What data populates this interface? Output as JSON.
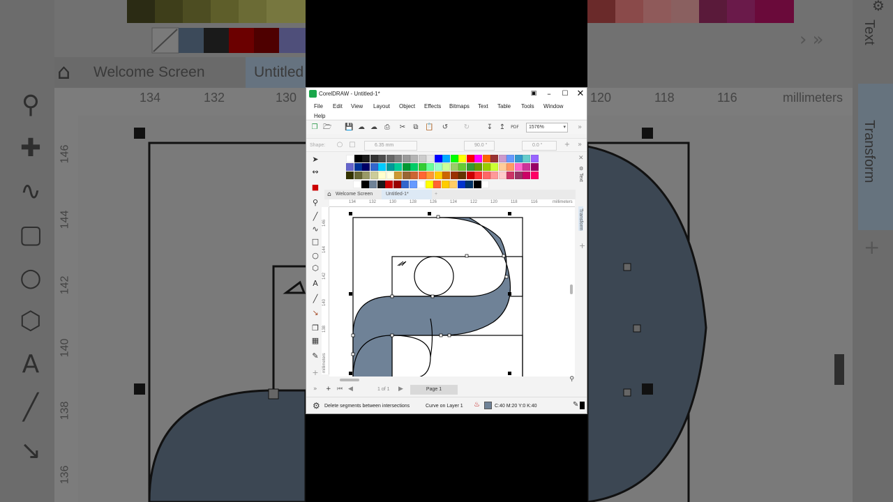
{
  "app": {
    "title": "CorelDRAW - Untitled-1*",
    "logo_color": "#1aa64a",
    "window_controls": [
      "minimize-icon",
      "maximize-icon",
      "close-icon"
    ]
  },
  "menus": [
    "File",
    "Edit",
    "View",
    "Layout",
    "Object",
    "Effects",
    "Bitmaps",
    "Text",
    "Table",
    "Tools",
    "Window",
    "Help"
  ],
  "toolbar": {
    "icons": [
      "new-document-icon",
      "open-icon",
      "save-icon",
      "cloud-download-icon",
      "cloud-upload-icon",
      "print-icon",
      "cut-icon",
      "copy-icon",
      "paste-icon",
      "undo-icon",
      "redo-icon",
      "import-icon",
      "export-icon",
      "pdf-icon"
    ],
    "pdf_label": "PDF",
    "zoom_value": "1576%"
  },
  "property_bar": {
    "shape_label": "Shape:",
    "outline_width": "6.35 mm",
    "angle_1": "90.0 °",
    "angle_2": "0.0 °"
  },
  "palette": {
    "rows": [
      [
        "#ffffff",
        "#000000",
        "#1a1a1a",
        "#333333",
        "#4d4d4d",
        "#666666",
        "#808080",
        "#999999",
        "#b3b3b3",
        "#cccccc",
        "#e6e6e6",
        "#0000ff",
        "#00aaff",
        "#00ff00",
        "#ffff00",
        "#ff0000",
        "#ff00ff",
        "#ff6600",
        "#993333",
        "#cc99cc",
        "#6699ff",
        "#3399cc",
        "#66cccc",
        "#9966ff"
      ],
      [
        "#6666cc",
        "#003399",
        "#000066",
        "#3366cc",
        "#00ccff",
        "#009999",
        "#00cc99",
        "#009933",
        "#00cc66",
        "#33cc33",
        "#66ff99",
        "#99ffcc",
        "#ccff99",
        "#99cc66",
        "#66cc33",
        "#339933",
        "#669900",
        "#99cc00",
        "#ccff33",
        "#ffcc99",
        "#ff9966",
        "#ff66cc",
        "#cc3399",
        "#990066"
      ],
      [
        "#333300",
        "#666633",
        "#999966",
        "#cccc99",
        "#ffffcc",
        "#ffffe0",
        "#cc9933",
        "#996633",
        "#cc6633",
        "#ff6633",
        "#ff9933",
        "#ffcc00",
        "#cc6600",
        "#993300",
        "#663300",
        "#cc0000",
        "#ff3333",
        "#ff6666",
        "#ff9999",
        "#ffcccc",
        "#cc3366",
        "#993366",
        "#cc0066",
        "#ff0066"
      ],
      [
        "#ffffff",
        "#000000",
        "#6f8297",
        "#1a1a1a",
        "#cc0000",
        "#990000",
        "#3366cc",
        "#6699ff",
        "#ffffff",
        "#ffff00",
        "#ff6633",
        "#ffcc00",
        "#ffcc66",
        "#0033cc",
        "#003366",
        "#000000",
        "#ffffff"
      ]
    ]
  },
  "tabs": {
    "welcome": "Welcome Screen",
    "document": "Untitled-1*",
    "add": "+"
  },
  "ruler": {
    "h_ticks": [
      "134",
      "132",
      "130",
      "128",
      "126",
      "124",
      "122",
      "120",
      "118",
      "116"
    ],
    "unit": "millimeters",
    "v_ticks": [
      "146",
      "144",
      "142",
      "140",
      "138",
      "136"
    ],
    "v_unit": "millimeters"
  },
  "drawing": {
    "fill_color": "#6f8297",
    "outline_color": "#000000"
  },
  "page_nav": {
    "page_count": "1 of 1",
    "page_tab": "Page 1"
  },
  "status": {
    "hint": "Delete segments between intersections",
    "object_info": "Curve on Layer 1",
    "fill_info": "C:40 M:20 Y:0 K:40",
    "fill_swatch": "#6f8297"
  },
  "dockers": {
    "text_tab": "Text",
    "transform_tab": "Transform"
  },
  "background": {
    "tab_welcome": "Welcome Screen",
    "tab_doc": "Untitled",
    "ruler_ticks": [
      "134",
      "132",
      "130",
      "120",
      "118",
      "116"
    ],
    "ruler_unit": "millimeters",
    "v_ticks": [
      "146",
      "144",
      "142",
      "140",
      "138",
      "136"
    ],
    "docker_text": "Text",
    "docker_transform": "Transform"
  }
}
